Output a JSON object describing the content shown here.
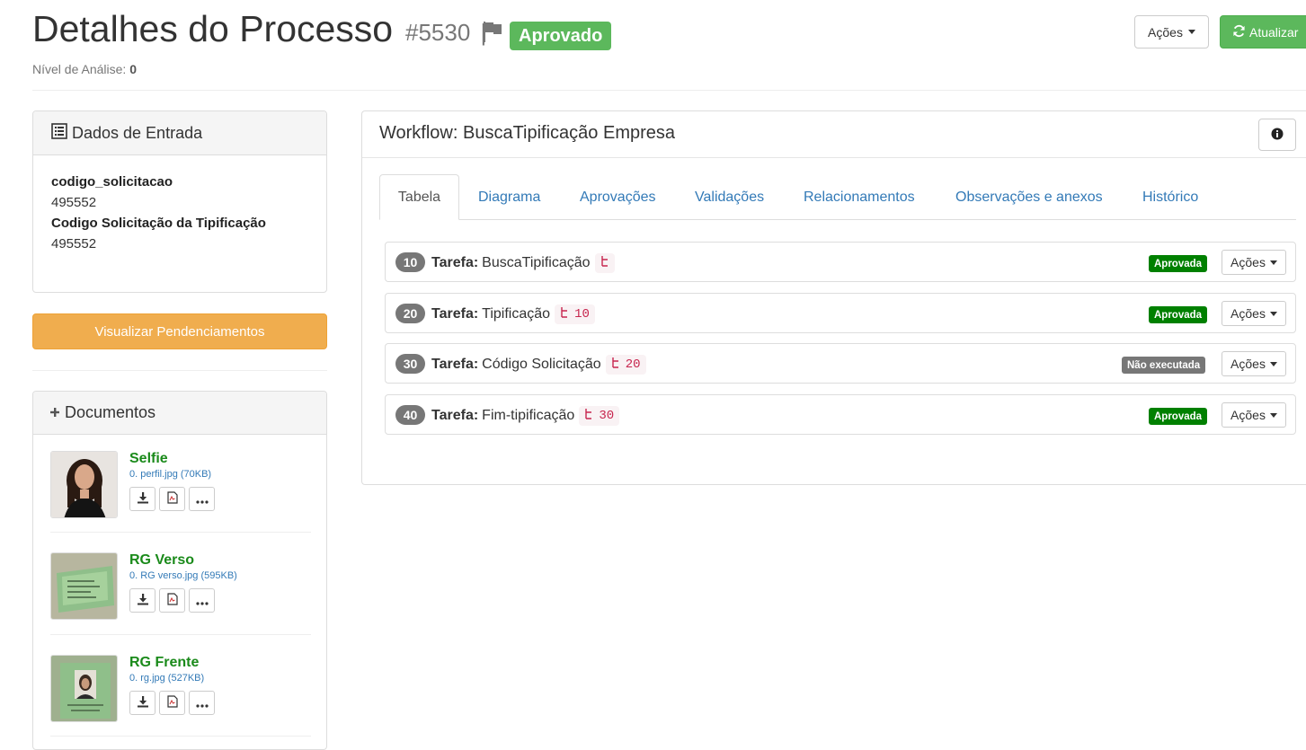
{
  "header": {
    "title": "Detalhes do Processo",
    "process_id": "#5530",
    "separator": "|",
    "status": "Aprovado",
    "level_label": "Nível de Análise:",
    "level_value": "0",
    "actions_label": "Ações",
    "refresh_label": "Atualizar",
    "status_color": "#5cb85c"
  },
  "entrada": {
    "title": "Dados de Entrada",
    "fields": [
      {
        "name": "codigo_solicitacao",
        "value": "495552"
      },
      {
        "name": "Codigo Solicitação da Tipificação",
        "value": "495552"
      }
    ]
  },
  "pendencias_button": "Visualizar Pendenciamentos",
  "documentos": {
    "title": "Documentos",
    "items": [
      {
        "title": "Selfie",
        "file": "0. perfil.jpg (70KB)",
        "thumb": "person-photo"
      },
      {
        "title": "RG Verso",
        "file": "0. RG verso.jpg (595KB)",
        "thumb": "green-document"
      },
      {
        "title": "RG Frente",
        "file": "0. rg.jpg (527KB)",
        "thumb": "id-card-photo"
      }
    ]
  },
  "workflow": {
    "title": "Workflow: BuscaTipificação Empresa",
    "tabs": [
      "Tabela",
      "Diagrama",
      "Aprovações",
      "Validações",
      "Relacionamentos",
      "Observações e anexos",
      "Histórico"
    ],
    "active_tab": "Tabela",
    "task_label": "Tarefa:",
    "actions_label": "Ações",
    "tasks": [
      {
        "num": "10",
        "name": "BuscaTipificação",
        "dep": "",
        "status": "Aprovada",
        "status_color": "#008000"
      },
      {
        "num": "20",
        "name": "Tipificação",
        "dep": "10",
        "status": "Aprovada",
        "status_color": "#008000"
      },
      {
        "num": "30",
        "name": "Código Solicitação",
        "dep": "20",
        "status": "Não executada",
        "status_color": "#777777"
      },
      {
        "num": "40",
        "name": "Fim-tipificação",
        "dep": "30",
        "status": "Aprovada",
        "status_color": "#008000"
      }
    ]
  }
}
